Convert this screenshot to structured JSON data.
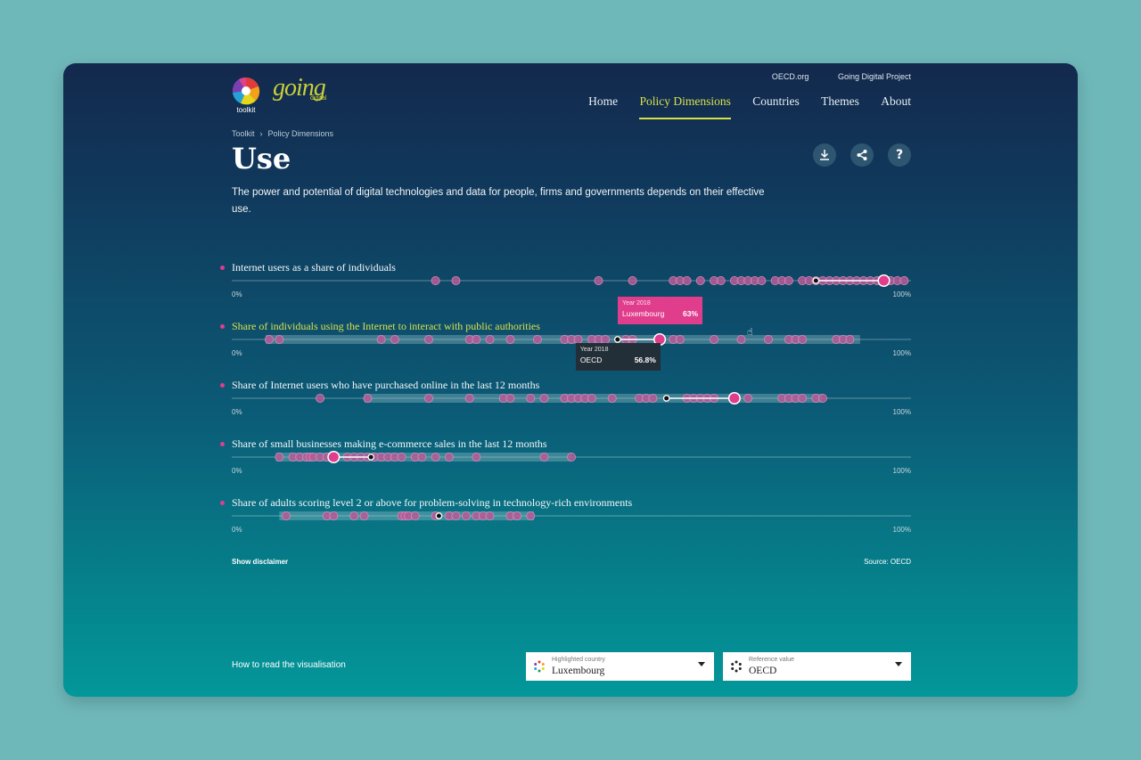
{
  "header": {
    "logo_label": "toolkit",
    "brand": "going",
    "brand_sub": "digital",
    "top_links": [
      "OECD.org",
      "Going Digital Project"
    ],
    "nav": [
      {
        "label": "Home",
        "active": false
      },
      {
        "label": "Policy Dimensions",
        "active": true
      },
      {
        "label": "Countries",
        "active": false
      },
      {
        "label": "Themes",
        "active": false
      },
      {
        "label": "About",
        "active": false
      }
    ]
  },
  "breadcrumb": [
    "Toolkit",
    "Policy Dimensions"
  ],
  "page": {
    "title": "Use",
    "description": "The power and potential of digital technologies and data for people, firms and governments depends on their effective use."
  },
  "actions": {
    "download_icon": "download-icon",
    "share_icon": "share-icon",
    "help_icon": "?"
  },
  "chart_data": {
    "type": "scatter",
    "x_range": [
      0,
      100
    ],
    "x_unit": "%",
    "axis_min_label": "0%",
    "axis_max_label": "100%",
    "colors": {
      "country": "#e03e8c",
      "highlight": "#e03e8c",
      "reference": "#000000",
      "label_highlight": "#d7e04a"
    },
    "indicators": [
      {
        "label": "Internet users as a share of individuals",
        "highlighted_label": false,
        "highlight": 96,
        "reference": 86,
        "range": [
          99.5,
          99.5
        ],
        "values": [
          30,
          33,
          54,
          59,
          65,
          66,
          67,
          69,
          71,
          72,
          74,
          75,
          76,
          77,
          78,
          80,
          81,
          82,
          84,
          85,
          86,
          87,
          88,
          89,
          90,
          91,
          92,
          93,
          94,
          95,
          97,
          98,
          99
        ]
      },
      {
        "label": "Share of individuals using the Internet to interact with public authorities",
        "highlighted_label": true,
        "highlight": 63,
        "reference": 56.8,
        "range": [
          5,
          92.5
        ],
        "values": [
          5.5,
          7,
          22,
          24,
          29,
          35,
          36,
          38,
          41,
          45,
          49,
          50,
          51,
          53,
          54,
          55,
          58,
          59,
          65,
          66,
          71,
          75,
          79,
          82,
          83,
          84,
          89,
          90,
          91
        ]
      },
      {
        "label": "Share of Internet users who have purchased online in the last 12 months",
        "highlighted_label": false,
        "highlight": 74,
        "reference": 64,
        "range": [
          19.5,
          87
        ],
        "values": [
          13,
          20,
          29,
          35,
          40,
          41,
          44,
          46,
          49,
          50,
          51,
          52,
          53,
          56,
          60,
          61,
          62,
          67,
          68,
          69,
          70,
          71,
          76,
          81,
          82,
          83,
          84,
          86,
          87
        ]
      },
      {
        "label": "Share of small businesses making e-commerce sales in the last 12 months",
        "highlighted_label": false,
        "highlight": 15,
        "reference": 20.5,
        "range": [
          6.5,
          50
        ],
        "values": [
          7,
          9,
          10,
          11,
          11.5,
          12,
          13,
          14,
          17,
          18,
          19,
          20,
          21,
          22,
          23,
          24,
          25,
          27,
          28,
          30,
          32,
          36,
          46,
          50
        ]
      },
      {
        "label": "Share of adults scoring level 2 or above for problem-solving in technology-rich environments",
        "highlighted_label": false,
        "highlight": null,
        "reference": 30.5,
        "range": [
          7,
          44.5
        ],
        "values": [
          8,
          14,
          15,
          18,
          19.5,
          25,
          25.5,
          26,
          27,
          30,
          32,
          33,
          34.5,
          36,
          37,
          38,
          41,
          42,
          44
        ]
      }
    ],
    "tooltips": [
      {
        "indicator": 1,
        "kind": "highlight",
        "year_label": "Year 2018",
        "name": "Luxembourg",
        "value_label": "63%"
      },
      {
        "indicator": 1,
        "kind": "reference",
        "year_label": "Year 2018",
        "name": "OECD",
        "value_label": "56.8%"
      }
    ]
  },
  "footer": {
    "disclaimer": "Show disclaimer",
    "source": "Source: OECD",
    "how_to": "How to read the visualisation",
    "highlighted_country": {
      "caption": "Highlighted country",
      "value": "Luxembourg"
    },
    "reference_value": {
      "caption": "Reference value",
      "value": "OECD"
    }
  }
}
